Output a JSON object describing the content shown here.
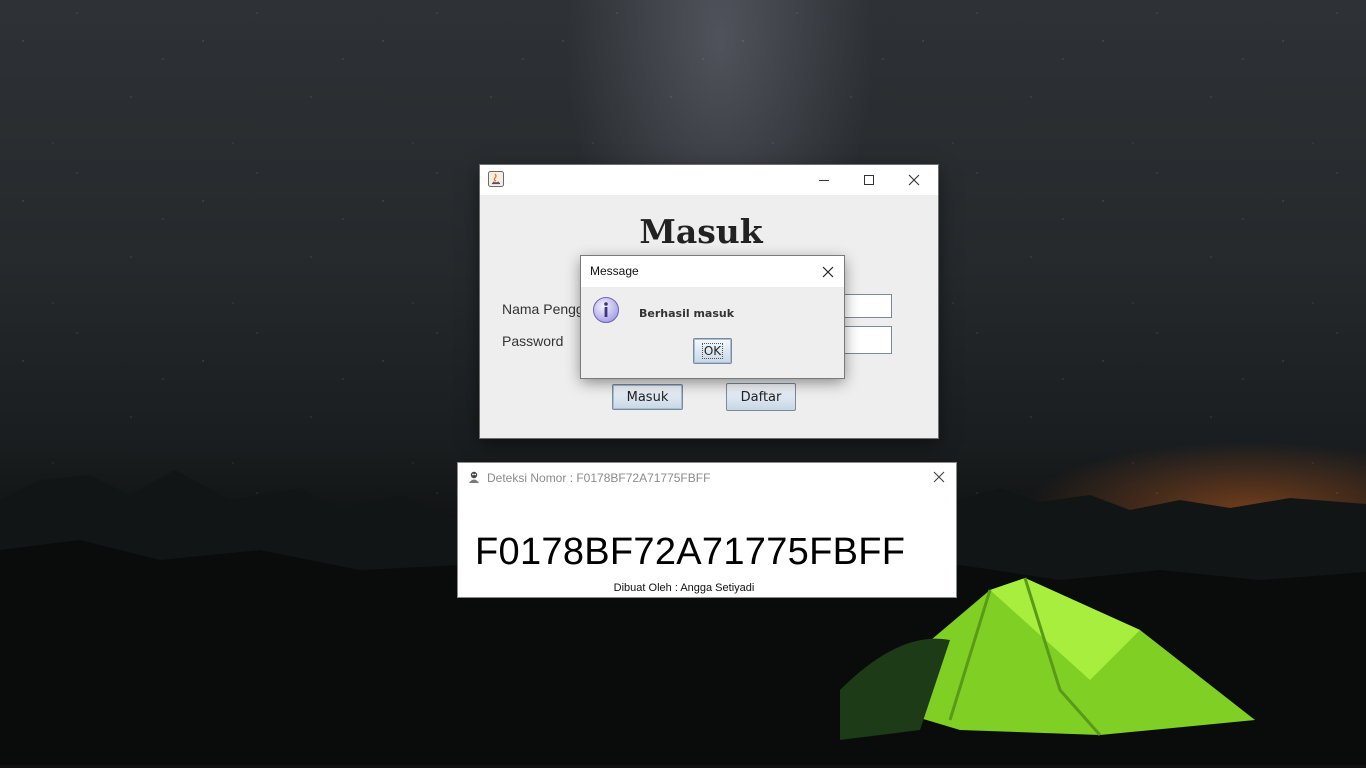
{
  "colors": {
    "window_bg": "#eeeeee",
    "titlebar_bg": "#ffffff",
    "button_border": "#7a8a99",
    "tent_green": "#8ee02a",
    "horizon_orange": "#be5f23"
  },
  "login_window": {
    "window_title": "",
    "icon": "java-icon",
    "title_controls": [
      "minimize-icon",
      "maximize-icon",
      "close-icon"
    ],
    "heading": "Masuk",
    "username_label": "Nama Pengg",
    "password_label": "Password",
    "username_value": "",
    "password_value": "",
    "login_button": "Masuk",
    "register_button": "Daftar"
  },
  "message_dialog": {
    "title": "Message",
    "icon": "info-icon",
    "message": "Berhasil masuk",
    "ok_button": "OK"
  },
  "detect_window": {
    "title": "Deteksi Nomor : F0178BF72A71775FBFF",
    "icon": "app-icon",
    "code": "F0178BF72A71775FBFF",
    "credit": "Dibuat Oleh : Angga Setiyadi"
  }
}
